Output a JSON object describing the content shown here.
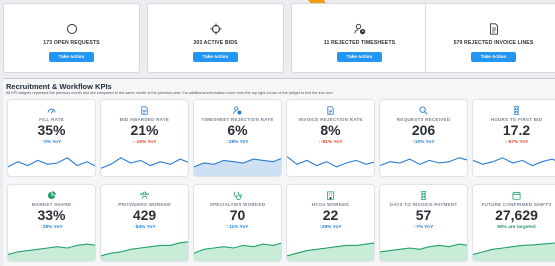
{
  "colors": {
    "accent": "#2196f3",
    "up": "#1e7fd6",
    "down": "#e0442f",
    "spark_line": "#2b7bd0",
    "spark_area": "#cde0f4",
    "spark_green_line": "#22a06b",
    "spark_green_area": "#c9ecd9",
    "orange": "#f39c12"
  },
  "action_cards": [
    {
      "icon": "circle-icon",
      "label": "173 OPEN REQUESTS",
      "button": "Take Action"
    },
    {
      "icon": "crosshair-icon",
      "label": "303 ACTIVE BIDS",
      "button": "Take Action"
    },
    {
      "icon": "user-clock-icon",
      "label": "11 REJECTED TIMESHEETS",
      "button": "Take Action"
    },
    {
      "icon": "document-icon",
      "label": "579 REJECTED INVOICE LINES",
      "button": "Take Action"
    }
  ],
  "kpi_section": {
    "title": "Recruitment & Workflow KPIs",
    "subtitle": "All KPI widgets represent the previous month and are compared to the same month of the previous year. For additional information hover over the top right corner of the widget to find the info icon"
  },
  "kpis": [
    {
      "icon": "gauge-icon",
      "name": "FILL RATE",
      "value": "35%",
      "delta": "↑0% YoY",
      "trend": "up",
      "spark": [
        0.35,
        0.55,
        0.4,
        0.6,
        0.45,
        0.5,
        0.7,
        0.4,
        0.55,
        0.35
      ],
      "style": "line"
    },
    {
      "icon": "document-icon",
      "name": "BID AWARDED RATE",
      "value": "21%",
      "delta": "↓-19% YoY",
      "trend": "down",
      "spark": [
        0.3,
        0.45,
        0.7,
        0.5,
        0.6,
        0.4,
        0.55,
        0.45,
        0.65,
        0.5
      ],
      "style": "line"
    },
    {
      "icon": "user-clock-icon",
      "name": "TIMESHEET REJECTION RATE",
      "value": "6%",
      "delta": "↑28% YoY",
      "trend": "up",
      "spark": [
        0.35,
        0.5,
        0.45,
        0.6,
        0.55,
        0.5,
        0.65,
        0.6,
        0.55,
        0.7
      ],
      "style": "area"
    },
    {
      "icon": "document-icon",
      "name": "INVOICE REJECTION RATE",
      "value": "8%",
      "delta": "↓-81% YoY",
      "trend": "down",
      "spark": [
        0.75,
        0.45,
        0.6,
        0.4,
        0.55,
        0.35,
        0.5,
        0.6,
        0.45,
        0.55
      ],
      "style": "line"
    },
    {
      "icon": "search-icon",
      "name": "REQUESTS RECEIVED",
      "value": "206",
      "delta": "↑10% YoY",
      "trend": "up",
      "spark": [
        0.4,
        0.55,
        0.5,
        0.65,
        0.45,
        0.6,
        0.5,
        0.55,
        0.7,
        0.6
      ],
      "style": "line"
    },
    {
      "icon": "hourglass-icon",
      "name": "HOURS TO FIRST BID",
      "value": "17.2",
      "delta": "↓-67% YoY",
      "trend": "down",
      "spark": [
        0.6,
        0.45,
        0.55,
        0.7,
        0.5,
        0.6,
        0.4,
        0.55,
        0.65,
        0.5
      ],
      "style": "line"
    },
    {
      "icon": "pie-icon",
      "name": "MARKET SHARE",
      "value": "33%",
      "delta": "↑29% YoY",
      "trend": "up",
      "spark": [
        0.25,
        0.35,
        0.4,
        0.45,
        0.5,
        0.55,
        0.5,
        0.6,
        0.65,
        0.6
      ],
      "style": "green"
    },
    {
      "icon": "users-icon",
      "name": "PROVIDERS WORKED",
      "value": "429",
      "delta": "↑54% YoY",
      "trend": "up",
      "spark": [
        0.2,
        0.3,
        0.35,
        0.45,
        0.5,
        0.55,
        0.6,
        0.6,
        0.7,
        0.75
      ],
      "style": "green"
    },
    {
      "icon": "stethoscope-icon",
      "name": "SPECIALTIES WORKED",
      "value": "70",
      "delta": "↑11% YoY",
      "trend": "up",
      "spark": [
        0.3,
        0.45,
        0.5,
        0.55,
        0.5,
        0.6,
        0.55,
        0.65,
        0.6,
        0.7
      ],
      "style": "green"
    },
    {
      "icon": "building-icon",
      "name": "HCOs WORKED",
      "value": "22",
      "delta": "↑29% YoY",
      "trend": "up",
      "spark": [
        0.2,
        0.3,
        0.4,
        0.45,
        0.5,
        0.55,
        0.6,
        0.6,
        0.65,
        0.7
      ],
      "style": "green"
    },
    {
      "icon": "hourglass-icon",
      "name": "DAYS TO INVOICE PAYMENT",
      "value": "57",
      "delta": "↑7% YoY",
      "trend": "up",
      "spark": [
        0.35,
        0.4,
        0.45,
        0.5,
        0.45,
        0.55,
        0.6,
        0.55,
        0.65,
        0.6
      ],
      "style": "green"
    },
    {
      "icon": "calendar-icon",
      "name": "FUTURE CONFIRMED SHIFTS",
      "value": "27,629",
      "delta": "89% are targeted",
      "trend": "up",
      "spark": [
        0.25,
        0.35,
        0.45,
        0.5,
        0.55,
        0.6,
        0.62,
        0.65,
        0.68,
        0.72
      ],
      "style": "green"
    }
  ]
}
